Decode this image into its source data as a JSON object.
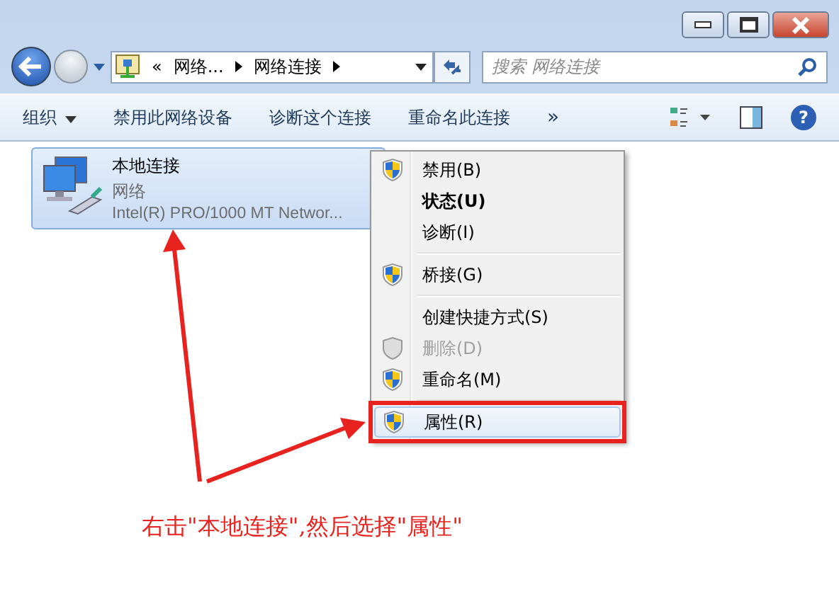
{
  "address": {
    "overflow": "«",
    "breadcrumbs": [
      {
        "label": "网络..."
      },
      {
        "label": "网络连接"
      }
    ]
  },
  "search": {
    "placeholder": "搜索 网络连接"
  },
  "toolbar": {
    "items": [
      {
        "label": "组织",
        "dropdown": true
      },
      {
        "label": "禁用此网络设备",
        "dropdown": false
      },
      {
        "label": "诊断这个连接",
        "dropdown": false
      },
      {
        "label": "重命名此连接",
        "dropdown": false
      }
    ],
    "more": "»",
    "help": "?"
  },
  "connections": [
    {
      "name": "本地连接",
      "network": "网络",
      "adapter": "Intel(R) PRO/1000 MT Networ...",
      "selected": true
    }
  ],
  "context_menu": {
    "items": [
      {
        "kind": "item",
        "label": "禁用(B)",
        "shield": true,
        "bold": false,
        "disabled": false,
        "selected": false
      },
      {
        "kind": "item",
        "label": "状态(U)",
        "shield": false,
        "bold": true,
        "disabled": false,
        "selected": false
      },
      {
        "kind": "item",
        "label": "诊断(I)",
        "shield": false,
        "bold": false,
        "disabled": false,
        "selected": false
      },
      {
        "kind": "separator"
      },
      {
        "kind": "item",
        "label": "桥接(G)",
        "shield": true,
        "bold": false,
        "disabled": false,
        "selected": false
      },
      {
        "kind": "separator"
      },
      {
        "kind": "item",
        "label": "创建快捷方式(S)",
        "shield": false,
        "bold": false,
        "disabled": false,
        "selected": false
      },
      {
        "kind": "item",
        "label": "删除(D)",
        "shield": true,
        "bold": false,
        "disabled": true,
        "selected": false
      },
      {
        "kind": "item",
        "label": "重命名(M)",
        "shield": true,
        "bold": false,
        "disabled": false,
        "selected": false
      },
      {
        "kind": "separator"
      },
      {
        "kind": "item",
        "label": "属性(R)",
        "shield": true,
        "bold": false,
        "disabled": false,
        "selected": true
      }
    ]
  },
  "annotation": {
    "text": "右击\"本地连接\",然后选择\"属性\""
  }
}
